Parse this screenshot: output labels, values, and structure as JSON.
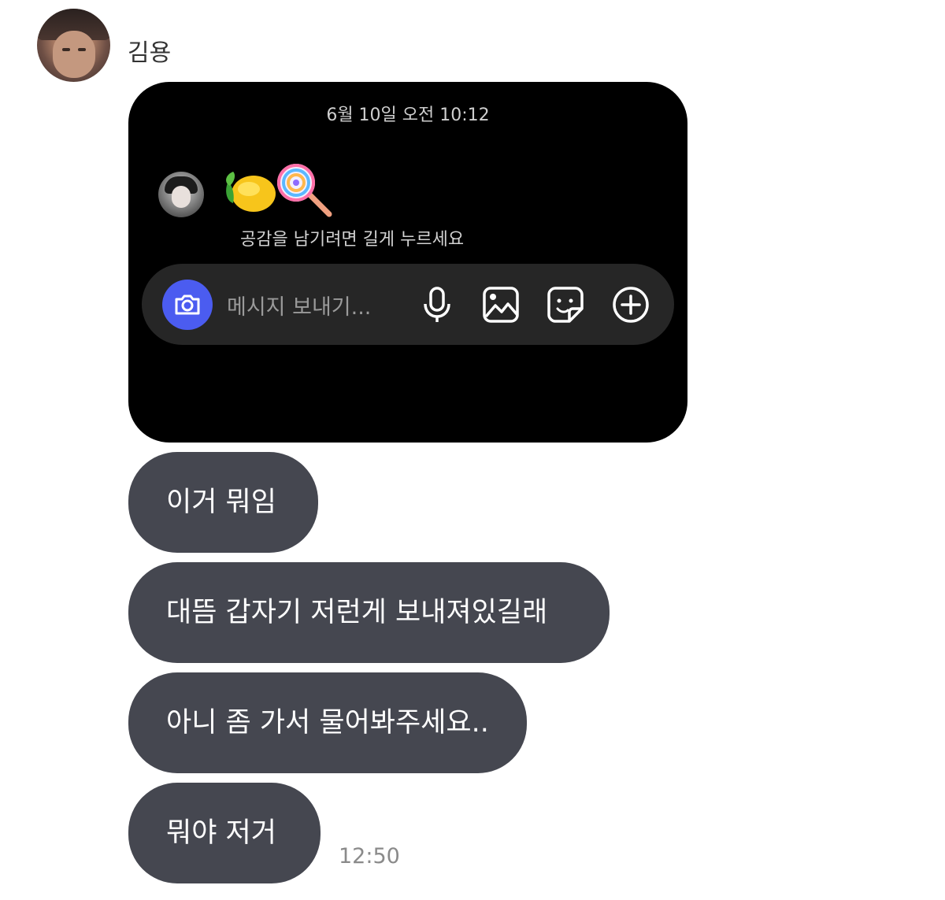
{
  "chat": {
    "sender_name": "김용",
    "screenshot": {
      "timestamp": "6월 10일 오전 10:12",
      "reaction_hint": "공감을 남기려면 길게 누르세요",
      "input_placeholder": "메시지 보내기...",
      "emojis": [
        "lemon",
        "lollipop"
      ]
    },
    "messages": [
      {
        "text": "이거 뭐임"
      },
      {
        "text": "대뜸 갑자기 저런게 보내져있길래"
      },
      {
        "text": "아니 좀 가서 물어봐주세요.."
      },
      {
        "text": "뭐야 저거"
      }
    ],
    "last_time": "12:50"
  },
  "icons": {
    "camera": "camera-icon",
    "mic": "microphone-icon",
    "gallery": "gallery-icon",
    "sticker": "sticker-icon",
    "plus": "plus-circle-icon"
  },
  "colors": {
    "bubble": "#454750",
    "camera_button": "#4b5cf0",
    "screenshot_bg": "#000000",
    "input_bar": "#262626"
  }
}
